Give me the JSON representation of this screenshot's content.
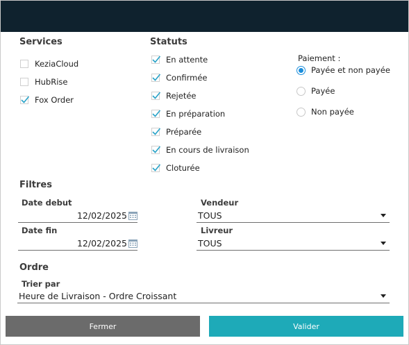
{
  "colors": {
    "titlebar": "#0f222e",
    "accent": "#1a8ddb",
    "check": "#2aa3c8",
    "close_button": "#6b6b6b",
    "validate_button": "#1eaab8"
  },
  "services": {
    "title": "Services",
    "items": [
      {
        "label": "KeziaCloud",
        "checked": false
      },
      {
        "label": "HubRise",
        "checked": false
      },
      {
        "label": "Fox Order",
        "checked": true
      }
    ]
  },
  "statuts": {
    "title": "Statuts",
    "items": [
      {
        "label": "En attente",
        "checked": true
      },
      {
        "label": "Confirmée",
        "checked": true
      },
      {
        "label": "Rejetée",
        "checked": true
      },
      {
        "label": "En préparation",
        "checked": true
      },
      {
        "label": "Préparée",
        "checked": true
      },
      {
        "label": "En cours de livraison",
        "checked": true
      },
      {
        "label": "Cloturée",
        "checked": true
      }
    ]
  },
  "paiement": {
    "title": "Paiement :",
    "options": [
      {
        "label": "Payée et non payée",
        "selected": true
      },
      {
        "label": "Payée",
        "selected": false
      },
      {
        "label": "Non payée",
        "selected": false
      }
    ]
  },
  "filtres": {
    "title": "Filtres",
    "date_debut": {
      "label": "Date debut",
      "value": "12/02/2025"
    },
    "date_fin": {
      "label": "Date fin",
      "value": "12/02/2025"
    },
    "vendeur": {
      "label": "Vendeur",
      "value": "TOUS"
    },
    "livreur": {
      "label": "Livreur",
      "value": "TOUS"
    }
  },
  "ordre": {
    "title": "Ordre",
    "trier_par": {
      "label": "Trier par",
      "value": "Heure de Livraison - Ordre Croissant"
    }
  },
  "buttons": {
    "fermer": "Fermer",
    "valider": "Valider"
  }
}
